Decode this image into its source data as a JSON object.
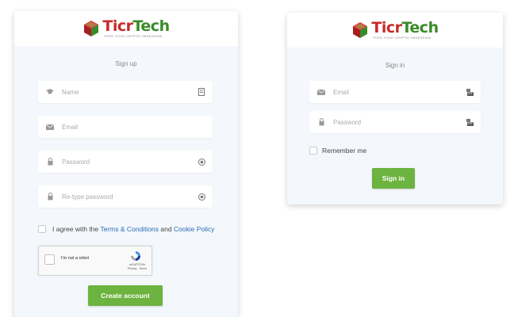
{
  "brand": {
    "logo_text_part1": "Ticr",
    "logo_text_part2": "Tech",
    "tagline": "FEED YOUR CRYPTO OBSESSION",
    "colors": {
      "red": "#c92a2a",
      "green": "#3a8a2a",
      "button": "#6cb33f",
      "link": "#2a6db5"
    }
  },
  "signup": {
    "title": "Sign up",
    "fields": {
      "name": {
        "placeholder": "Name",
        "icon": "graduation-cap-icon",
        "trail_icon": "id-card-icon"
      },
      "email": {
        "placeholder": "Email",
        "icon": "envelope-icon"
      },
      "password": {
        "placeholder": "Password",
        "icon": "lock-icon",
        "trail_icon": "eye-icon"
      },
      "retype": {
        "placeholder": "Re-type password",
        "icon": "lock-icon",
        "trail_icon": "eye-icon"
      }
    },
    "agree": {
      "prefix": "I agree with the ",
      "terms": "Terms & Conditions",
      "middle": " and ",
      "cookie": "Cookie Policy"
    },
    "recaptcha": {
      "label": "I'm not a robot",
      "brand": "reCAPTCHA",
      "links": "Privacy - Terms"
    },
    "submit_label": "Create account"
  },
  "signin": {
    "title": "Sign in",
    "fields": {
      "email": {
        "placeholder": "Email",
        "icon": "envelope-icon",
        "trail_icon": "keyboard-icon"
      },
      "password": {
        "placeholder": "Password",
        "icon": "lock-icon",
        "trail_icon": "keyboard-icon"
      }
    },
    "remember_label": "Remember me",
    "submit_label": "Sign in"
  }
}
